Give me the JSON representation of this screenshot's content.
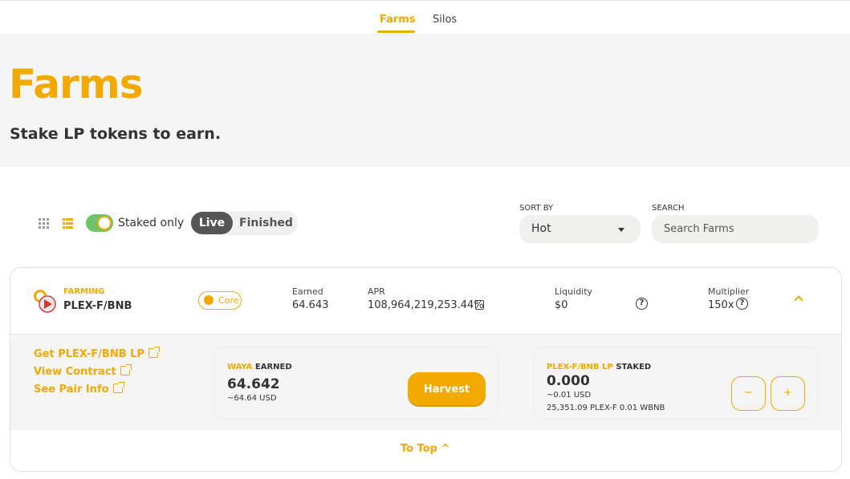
{
  "subnav": {
    "tabs": [
      {
        "label": "Farms"
      },
      {
        "label": "Silos"
      }
    ]
  },
  "hero": {
    "title": "Farms",
    "subtitle": "Stake LP tokens to earn."
  },
  "controls": {
    "view_grid_icon": "grid-icon",
    "view_list_icon": "list-icon",
    "staked_only_label": "Staked only",
    "staked_only_on": true,
    "status_tabs": {
      "live": "Live",
      "finished": "Finished"
    },
    "sort": {
      "label": "SORT BY",
      "value": "Hot"
    },
    "search": {
      "label": "SEARCH",
      "placeholder": "Search Farms"
    }
  },
  "farm": {
    "tag": "FARMING",
    "pair": "PLEX-F/BNB",
    "badge": "Core",
    "earned": {
      "label": "Earned",
      "value": "64.643"
    },
    "apr": {
      "label": "APR",
      "value": "108,964,219,253.44%"
    },
    "liquidity": {
      "label": "Liquidity",
      "value": "$0"
    },
    "multiplier": {
      "label": "Multiplier",
      "value": "150x"
    },
    "links": [
      {
        "label": "Get PLEX-F/BNB LP"
      },
      {
        "label": "View Contract"
      },
      {
        "label": "See Pair Info"
      }
    ],
    "earned_panel": {
      "token": "WAYA",
      "title_suffix": " EARNED",
      "amount": "64.642",
      "usd": "~64.64 USD",
      "harvest_label": "Harvest"
    },
    "staked_panel": {
      "token": "PLEX-F/BNB LP",
      "title_suffix": " STAKED",
      "amount": "0.000",
      "usd": "~0.01 USD",
      "breakdown": "25,351.09 PLEX-F  0.01 WBNB",
      "minus": "−",
      "plus": "+"
    },
    "to_top": "To Top ^"
  },
  "colors": {
    "accent": "#f2a900",
    "toggle_track": "#6fc26b",
    "dark_pill": "#555555",
    "hero_bg": "#f5f5f5"
  }
}
